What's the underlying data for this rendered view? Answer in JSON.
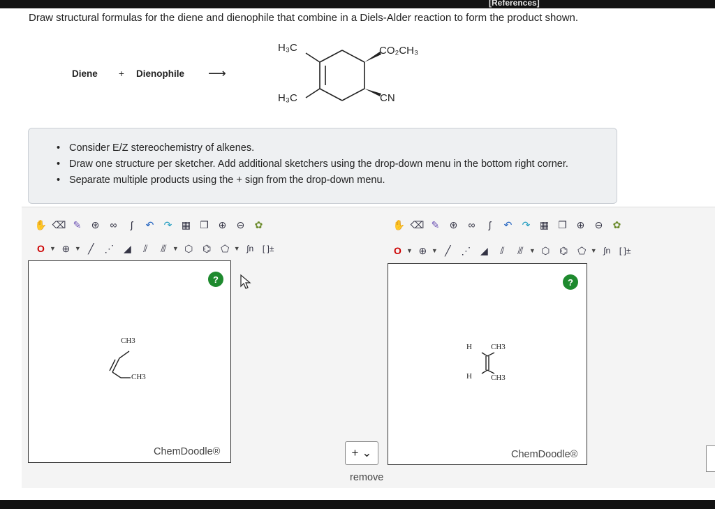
{
  "header": {
    "references_label": "[References]"
  },
  "question": {
    "text": "Draw structural formulas for the diene and dienophile that combine in a Diels-Alder reaction to form the product shown."
  },
  "reaction": {
    "diene": "Diene",
    "plus": "+",
    "dienophile": "Dienophile",
    "arrow": "⟶"
  },
  "product": {
    "sub_h3c_top": "H₃C",
    "sub_co2ch3": "CO₂CH₃",
    "sub_h3c_bottom": "H₃C",
    "sub_cn": "CN"
  },
  "instructions": [
    "Consider E/Z stereochemistry of alkenes.",
    "Draw one structure per sketcher. Add additional sketchers using the drop-down menu in the bottom right corner.",
    "Separate multiple products using the + sign from the drop-down menu."
  ],
  "toolbar": {
    "row1": [
      "hand-tool",
      "eraser-tool",
      "pen-tool",
      "ring-tool",
      "chain-tool",
      "label-tool",
      "undo",
      "redo",
      "template-tool",
      "copy-tool",
      "zoom-in",
      "zoom-out",
      "clean-tool"
    ],
    "atom_label": "O",
    "charge_label": "⊕",
    "sgroup_label": "∫n",
    "bracket_label": "[ ]±"
  },
  "sketcher1": {
    "help": "?",
    "brand": "ChemDoodle®",
    "molecule": {
      "label_top": "CH3",
      "label_bottom": "CH3"
    }
  },
  "sketcher2": {
    "help": "?",
    "brand": "ChemDoodle®",
    "molecule": {
      "label_h_top": "H",
      "label_ch3_top": "CH3",
      "label_h_bottom": "H",
      "label_ch3_bottom": "CH3"
    }
  },
  "add_sketcher": {
    "label": "+ ⌄"
  },
  "remove": {
    "label": "remove"
  },
  "colors": {
    "help_green": "#1e8a2e",
    "panel_bg": "#eef0f2"
  }
}
